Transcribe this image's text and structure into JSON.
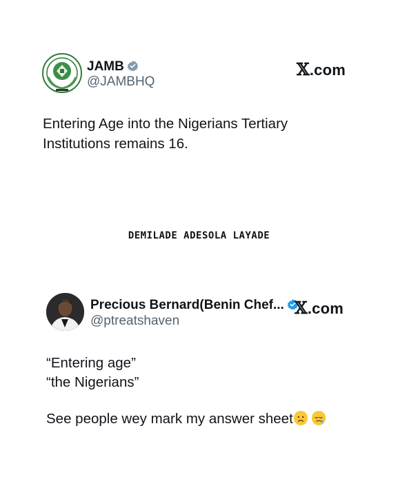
{
  "tweet1": {
    "name": "JAMB",
    "handle": "@JAMBHQ",
    "site": "X.com",
    "text": "Entering Age into the Nigerians Tertiary\nInstitutions remains 16.",
    "verified_color": "#829aab",
    "avatar_icon": "jamb-logo-icon"
  },
  "watermark": "DEMILADE ADESOLA LAYADE",
  "tweet2": {
    "name": "Precious Bernard(Benin Chef...",
    "handle": "@ptreatshaven",
    "site": "X.com",
    "quote_line1": "“Entering age”",
    "quote_line2": "“the Nigerians”",
    "comment": "See people wey mark my answer sheet",
    "verified_color": "#1d9bf0",
    "emojis": [
      "frowning-face-emoji",
      "pouting-face-emoji"
    ]
  }
}
